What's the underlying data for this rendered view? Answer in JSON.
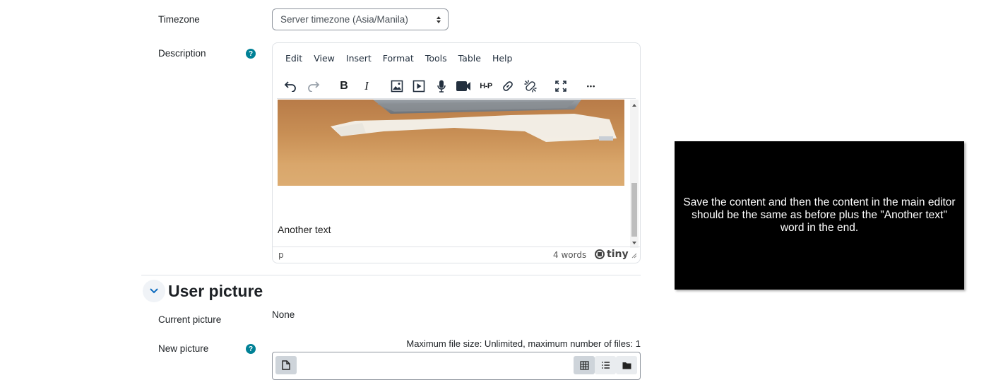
{
  "form": {
    "timezone_label": "Timezone",
    "timezone_value": "Server timezone (Asia/Manila)",
    "description_label": "Description",
    "help_glyph": "?"
  },
  "editor": {
    "menu": [
      "Edit",
      "View",
      "Insert",
      "Format",
      "Tools",
      "Table",
      "Help"
    ],
    "toolbar_icons": [
      "undo-icon",
      "redo-icon",
      "bold-icon",
      "italic-icon",
      "image-icon",
      "media-icon",
      "microphone-icon",
      "video-camera-icon",
      "h5p-icon",
      "link-icon",
      "unlink-icon",
      "fullscreen-icon",
      "more-icon"
    ],
    "bold_glyph": "B",
    "italic_glyph": "I",
    "h5p_glyph": "H-P",
    "more_glyph": "•••",
    "content_text": "Another text",
    "status_path": "p",
    "word_count": "4 words",
    "brand": "tiny"
  },
  "user_picture": {
    "section_title": "User picture",
    "current_label": "Current picture",
    "current_value": "None",
    "new_label": "New picture",
    "limits": "Maximum file size: Unlimited, maximum number of files: 1"
  },
  "overlay": {
    "text": "Save the content and then the content in the main editor should be the same as before plus the \"Another text\" word in the end."
  },
  "colors": {
    "help": "#008196",
    "overlay_bg": "#000000",
    "link": "#0f6cbf"
  }
}
